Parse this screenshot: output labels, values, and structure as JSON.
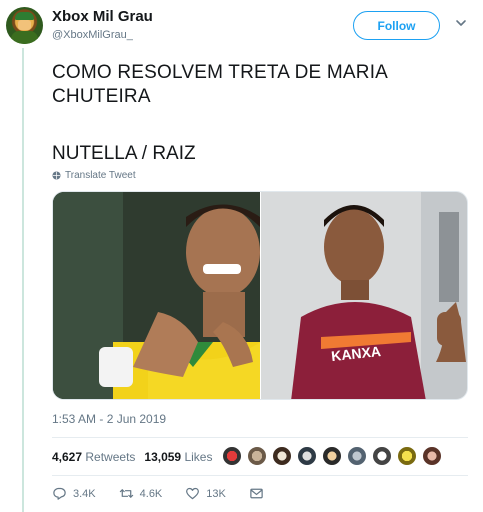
{
  "user": {
    "display_name": "Xbox Mil Grau",
    "handle": "@XboxMilGrau_"
  },
  "follow_label": "Follow",
  "tweet": {
    "text_line1": "COMO RESOLVEM TRETA DE MARIA CHUTEIRA",
    "text_line2": "NUTELLA / RAIZ",
    "translate_label": "Translate Tweet",
    "timestamp": "1:53 AM - 2 Jun 2019"
  },
  "media": {
    "left_jersey_text": "",
    "right_jersey_text": "KANXA"
  },
  "stats": {
    "retweets_count": "4,627",
    "retweets_label": "Retweets",
    "likes_count": "13,059",
    "likes_label": "Likes"
  },
  "actions": {
    "reply_count": "3.4K",
    "retweet_count": "4.6K",
    "like_count": "13K"
  },
  "colors": {
    "accent": "#1da1f2",
    "secondary_text": "#657786",
    "thread_line": "#cce6dd"
  }
}
